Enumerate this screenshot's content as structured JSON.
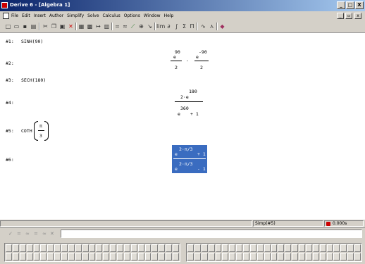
{
  "window": {
    "title": "Derive 6 - [Algebra 1]"
  },
  "window_controls": {
    "minimize": "_",
    "maximize": "□",
    "close": "X"
  },
  "mdi_controls": {
    "minimize": "_",
    "restore": "▫",
    "close": "x"
  },
  "menu": [
    "File",
    "Edit",
    "Insert",
    "Author",
    "Simplify",
    "Solve",
    "Calculus",
    "Options",
    "Window",
    "Help"
  ],
  "toolbar_icons": [
    "new-icon",
    "open-icon",
    "save-icon",
    "print-icon",
    "cut-icon",
    "copy-icon",
    "paste-icon",
    "delete-icon",
    "text-object-icon",
    "image-icon",
    "renumber-icon",
    "matrix-icon",
    "simplify-icon",
    "approximate-icon",
    "solve-icon",
    "substitute-icon",
    "limit-icon",
    "sum-icon",
    "derivative-icon",
    "integrate-icon",
    "sum-symbol-icon",
    "product-icon",
    "plot-2d-icon",
    "plot-3d-icon",
    "color-icon"
  ],
  "lines": {
    "l1": {
      "label": "#1:",
      "expr": "SINH(90)"
    },
    "l2": {
      "label": "#2:",
      "a_sup": "90",
      "a_base": "e",
      "a_den": "2",
      "op": "-",
      "b_sup": "-90",
      "b_base": "e",
      "b_den": "2"
    },
    "l3": {
      "label": "#3:",
      "expr": "SECH(180)"
    },
    "l4": {
      "label": "#4:",
      "num_coef": "2·e",
      "num_sup": "180",
      "den_base": "e",
      "den_sup": "360",
      "den_rest": "+ 1"
    },
    "l5": {
      "label": "#5:",
      "func": "COTH",
      "num": "π",
      "den": "3"
    },
    "l6": {
      "label": "#6:",
      "num_sup": "2·π/3",
      "num_base": "e",
      "num_rest": "+ 1",
      "den_sup": "2·π/3",
      "den_base": "e",
      "den_rest": "- 1"
    }
  },
  "status": {
    "simp": "Simp(#5)",
    "time": "0.000s"
  },
  "entry": {
    "value": ""
  },
  "colors": {
    "highlight": "#3a6cc0",
    "chrome": "#d4d0c8",
    "title_start": "#0a246a"
  }
}
